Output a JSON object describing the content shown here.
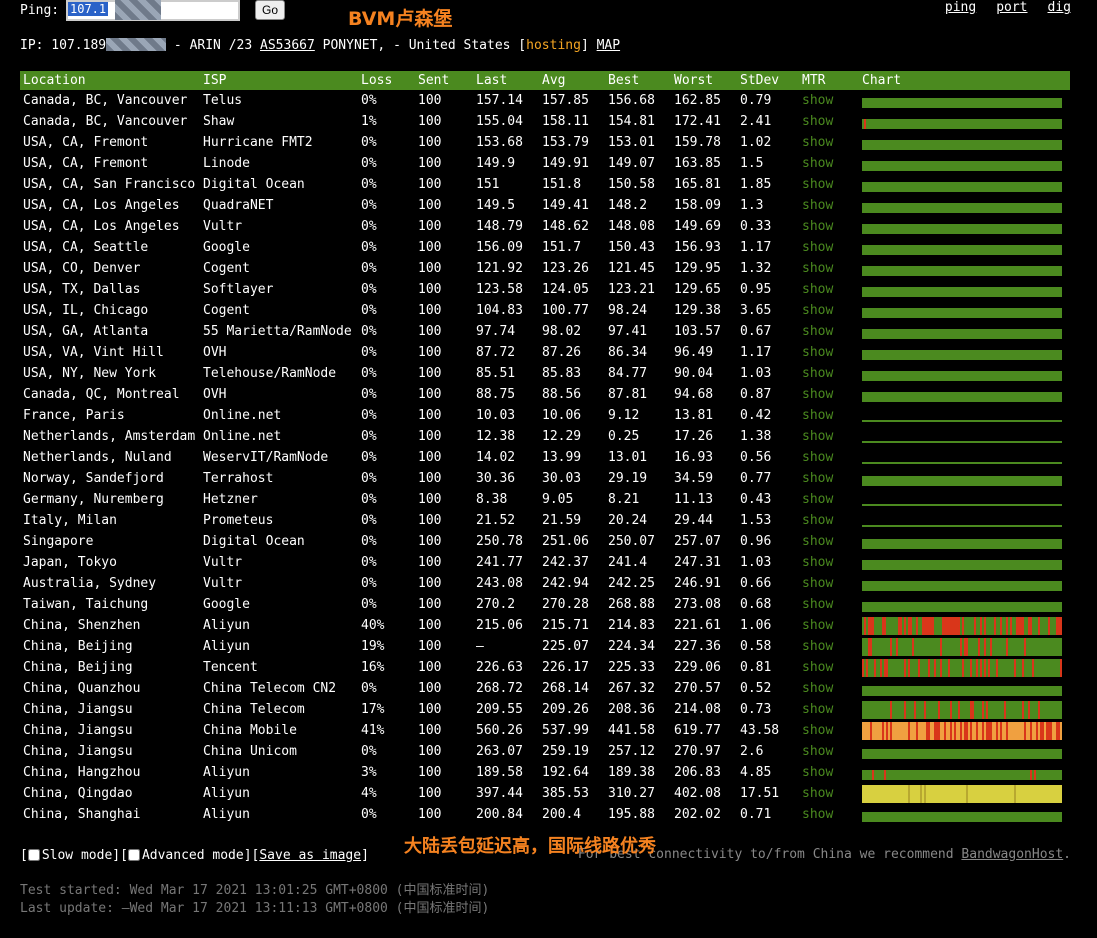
{
  "header": {
    "ping_label": "Ping:",
    "ping_input_value": "107.1",
    "go_label": "Go",
    "annotation": "BVM卢森堡",
    "links": [
      "ping",
      "port",
      "dig"
    ]
  },
  "ip_line": {
    "prefix": "IP: 107.189",
    "mid": " - ARIN /23 ",
    "asn": "AS53667",
    "org": " PONYNET, - United States [",
    "hosting": "hosting",
    "close": "] ",
    "map": "MAP"
  },
  "columns": [
    "Location",
    "ISP",
    "Loss",
    "Sent",
    "Last",
    "Avg",
    "Best",
    "Worst",
    "StDev",
    "MTR",
    "Chart"
  ],
  "rows": [
    {
      "location": "Canada, BC, Vancouver",
      "isp": "Telus",
      "loss": "0%",
      "sent": "100",
      "last": "157.14",
      "avg": "157.85",
      "best": "156.68",
      "worst": "162.85",
      "stdev": "0.79",
      "mtr": "show",
      "chart": "green"
    },
    {
      "location": "Canada, BC, Vancouver",
      "isp": "Shaw",
      "loss": "1%",
      "sent": "100",
      "last": "155.04",
      "avg": "158.11",
      "best": "154.81",
      "worst": "172.41",
      "stdev": "2.41",
      "mtr": "show",
      "chart": "green-mark"
    },
    {
      "location": "USA, CA, Fremont",
      "isp": "Hurricane FMT2",
      "loss": "0%",
      "sent": "100",
      "last": "153.68",
      "avg": "153.79",
      "best": "153.01",
      "worst": "159.78",
      "stdev": "1.02",
      "mtr": "show",
      "chart": "green"
    },
    {
      "location": "USA, CA, Fremont",
      "isp": "Linode",
      "loss": "0%",
      "sent": "100",
      "last": "149.9",
      "avg": "149.91",
      "best": "149.07",
      "worst": "163.85",
      "stdev": "1.5",
      "mtr": "show",
      "chart": "green"
    },
    {
      "location": "USA, CA, San Francisco",
      "isp": "Digital Ocean",
      "loss": "0%",
      "sent": "100",
      "last": "151",
      "avg": "151.8",
      "best": "150.58",
      "worst": "165.81",
      "stdev": "1.85",
      "mtr": "show",
      "chart": "green"
    },
    {
      "location": "USA, CA, Los Angeles",
      "isp": "QuadraNET",
      "loss": "0%",
      "sent": "100",
      "last": "149.5",
      "avg": "149.41",
      "best": "148.2",
      "worst": "158.09",
      "stdev": "1.3",
      "mtr": "show",
      "chart": "green"
    },
    {
      "location": "USA, CA, Los Angeles",
      "isp": "Vultr",
      "loss": "0%",
      "sent": "100",
      "last": "148.79",
      "avg": "148.62",
      "best": "148.08",
      "worst": "149.69",
      "stdev": "0.33",
      "mtr": "show",
      "chart": "green"
    },
    {
      "location": "USA, CA, Seattle",
      "isp": "Google",
      "loss": "0%",
      "sent": "100",
      "last": "156.09",
      "avg": "151.7",
      "best": "150.43",
      "worst": "156.93",
      "stdev": "1.17",
      "mtr": "show",
      "chart": "green"
    },
    {
      "location": "USA, CO, Denver",
      "isp": "Cogent",
      "loss": "0%",
      "sent": "100",
      "last": "121.92",
      "avg": "123.26",
      "best": "121.45",
      "worst": "129.95",
      "stdev": "1.32",
      "mtr": "show",
      "chart": "green"
    },
    {
      "location": "USA, TX, Dallas",
      "isp": "Softlayer",
      "loss": "0%",
      "sent": "100",
      "last": "123.58",
      "avg": "124.05",
      "best": "123.21",
      "worst": "129.65",
      "stdev": "0.95",
      "mtr": "show",
      "chart": "green"
    },
    {
      "location": "USA, IL, Chicago",
      "isp": "Cogent",
      "loss": "0%",
      "sent": "100",
      "last": "104.83",
      "avg": "100.77",
      "best": "98.24",
      "worst": "129.38",
      "stdev": "3.65",
      "mtr": "show",
      "chart": "green"
    },
    {
      "location": "USA, GA, Atlanta",
      "isp": "55 Marietta/RamNode",
      "loss": "0%",
      "sent": "100",
      "last": "97.74",
      "avg": "98.02",
      "best": "97.41",
      "worst": "103.57",
      "stdev": "0.67",
      "mtr": "show",
      "chart": "green"
    },
    {
      "location": "USA, VA, Vint Hill",
      "isp": "OVH",
      "loss": "0%",
      "sent": "100",
      "last": "87.72",
      "avg": "87.26",
      "best": "86.34",
      "worst": "96.49",
      "stdev": "1.17",
      "mtr": "show",
      "chart": "green"
    },
    {
      "location": "USA, NY, New York",
      "isp": "Telehouse/RamNode",
      "loss": "0%",
      "sent": "100",
      "last": "85.51",
      "avg": "85.83",
      "best": "84.77",
      "worst": "90.04",
      "stdev": "1.03",
      "mtr": "show",
      "chart": "green"
    },
    {
      "location": "Canada, QC, Montreal",
      "isp": "OVH",
      "loss": "0%",
      "sent": "100",
      "last": "88.75",
      "avg": "88.56",
      "best": "87.81",
      "worst": "94.68",
      "stdev": "0.87",
      "mtr": "show",
      "chart": "green"
    },
    {
      "location": "France, Paris",
      "isp": "Online.net",
      "loss": "0%",
      "sent": "100",
      "last": "10.03",
      "avg": "10.06",
      "best": "9.12",
      "worst": "13.81",
      "stdev": "0.42",
      "mtr": "show",
      "chart": "thin"
    },
    {
      "location": "Netherlands, Amsterdam",
      "isp": "Online.net",
      "loss": "0%",
      "sent": "100",
      "last": "12.38",
      "avg": "12.29",
      "best": "0.25",
      "worst": "17.26",
      "stdev": "1.38",
      "mtr": "show",
      "chart": "thin"
    },
    {
      "location": "Netherlands, Nuland",
      "isp": "WeservIT/RamNode",
      "loss": "0%",
      "sent": "100",
      "last": "14.02",
      "avg": "13.99",
      "best": "13.01",
      "worst": "16.93",
      "stdev": "0.56",
      "mtr": "show",
      "chart": "thin"
    },
    {
      "location": "Norway, Sandefjord",
      "isp": "Terrahost",
      "loss": "0%",
      "sent": "100",
      "last": "30.36",
      "avg": "30.03",
      "best": "29.19",
      "worst": "34.59",
      "stdev": "0.77",
      "mtr": "show",
      "chart": "green"
    },
    {
      "location": "Germany, Nuremberg",
      "isp": "Hetzner",
      "loss": "0%",
      "sent": "100",
      "last": "8.38",
      "avg": "9.05",
      "best": "8.21",
      "worst": "11.13",
      "stdev": "0.43",
      "mtr": "show",
      "chart": "thin"
    },
    {
      "location": "Italy, Milan",
      "isp": "Prometeus",
      "loss": "0%",
      "sent": "100",
      "last": "21.52",
      "avg": "21.59",
      "best": "20.24",
      "worst": "29.44",
      "stdev": "1.53",
      "mtr": "show",
      "chart": "thin"
    },
    {
      "location": "Singapore",
      "isp": "Digital Ocean",
      "loss": "0%",
      "sent": "100",
      "last": "250.78",
      "avg": "251.06",
      "best": "250.07",
      "worst": "257.07",
      "stdev": "0.96",
      "mtr": "show",
      "chart": "green"
    },
    {
      "location": "Japan, Tokyo",
      "isp": "Vultr",
      "loss": "0%",
      "sent": "100",
      "last": "241.77",
      "avg": "242.37",
      "best": "241.4",
      "worst": "247.31",
      "stdev": "1.03",
      "mtr": "show",
      "chart": "green"
    },
    {
      "location": "Australia, Sydney",
      "isp": "Vultr",
      "loss": "0%",
      "sent": "100",
      "last": "243.08",
      "avg": "242.94",
      "best": "242.25",
      "worst": "246.91",
      "stdev": "0.66",
      "mtr": "show",
      "chart": "green"
    },
    {
      "location": "Taiwan, Taichung",
      "isp": "Google",
      "loss": "0%",
      "sent": "100",
      "last": "270.2",
      "avg": "270.28",
      "best": "268.88",
      "worst": "273.08",
      "stdev": "0.68",
      "mtr": "show",
      "chart": "green"
    },
    {
      "location": "China, Shenzhen",
      "isp": "Aliyun",
      "loss": "40%",
      "sent": "100",
      "last": "215.06",
      "avg": "215.71",
      "best": "214.83",
      "worst": "221.61",
      "stdev": "1.06",
      "mtr": "show",
      "chart": "loss-heavy"
    },
    {
      "location": "China, Beijing",
      "isp": "Aliyun",
      "loss": "19%",
      "sent": "100",
      "last": "–",
      "avg": "225.07",
      "best": "224.34",
      "worst": "227.36",
      "stdev": "0.58",
      "mtr": "show",
      "chart": "loss-mid"
    },
    {
      "location": "China, Beijing",
      "isp": "Tencent",
      "loss": "16%",
      "sent": "100",
      "last": "226.63",
      "avg": "226.17",
      "best": "225.33",
      "worst": "229.06",
      "stdev": "0.81",
      "mtr": "show",
      "chart": "loss-mid"
    },
    {
      "location": "China, Quanzhou",
      "isp": "China Telecom CN2",
      "loss": "0%",
      "sent": "100",
      "last": "268.72",
      "avg": "268.14",
      "best": "267.32",
      "worst": "270.57",
      "stdev": "0.52",
      "mtr": "show",
      "chart": "green"
    },
    {
      "location": "China, Jiangsu",
      "isp": "China Telecom",
      "loss": "17%",
      "sent": "100",
      "last": "209.55",
      "avg": "209.26",
      "best": "208.36",
      "worst": "214.08",
      "stdev": "0.73",
      "mtr": "show",
      "chart": "loss-mid"
    },
    {
      "location": "China, Jiangsu",
      "isp": "China Mobile",
      "loss": "41%",
      "sent": "100",
      "last": "560.26",
      "avg": "537.99",
      "best": "441.58",
      "worst": "619.77",
      "stdev": "43.58",
      "mtr": "show",
      "chart": "orange"
    },
    {
      "location": "China, Jiangsu",
      "isp": "China Unicom",
      "loss": "0%",
      "sent": "100",
      "last": "263.07",
      "avg": "259.19",
      "best": "257.12",
      "worst": "270.97",
      "stdev": "2.6",
      "mtr": "show",
      "chart": "green"
    },
    {
      "location": "China, Hangzhou",
      "isp": "Aliyun",
      "loss": "3%",
      "sent": "100",
      "last": "189.58",
      "avg": "192.64",
      "best": "189.38",
      "worst": "206.83",
      "stdev": "4.85",
      "mtr": "show",
      "chart": "loss-low"
    },
    {
      "location": "China, Qingdao",
      "isp": "Aliyun",
      "loss": "4%",
      "sent": "100",
      "last": "397.44",
      "avg": "385.53",
      "best": "310.27",
      "worst": "402.08",
      "stdev": "17.51",
      "mtr": "show",
      "chart": "yellow"
    },
    {
      "location": "China, Shanghai",
      "isp": "Aliyun",
      "loss": "0%",
      "sent": "100",
      "last": "200.84",
      "avg": "200.4",
      "best": "195.88",
      "worst": "202.02",
      "stdev": "0.71",
      "mtr": "show",
      "chart": "green"
    }
  ],
  "modes": {
    "open1": "[",
    "slow": "Slow mode",
    "sep": "][",
    "advanced": "Advanced mode",
    "sep2": "][",
    "save": "Save as image",
    "close": "]"
  },
  "annotation_bottom": "大陆丢包延迟高，国际线路优秀",
  "recommend": {
    "text": "For best connectivity to/from China we recommend ",
    "link": "BandwagonHost",
    "end": "."
  },
  "footer": {
    "started": "Test started: Wed Mar 17 2021 13:01:25 GMT+0800 (中国标准时间)",
    "updated": "Last update: —Wed Mar 17 2021 13:11:13 GMT+0800 (中国标准时间)"
  },
  "colors": {
    "header_green": "#4b8a1f",
    "chart_green": "#4b8a1f",
    "loss_red": "#d9361a",
    "orange": "#f0a040",
    "yellow": "#d8d040",
    "annotation": "#f58220"
  }
}
